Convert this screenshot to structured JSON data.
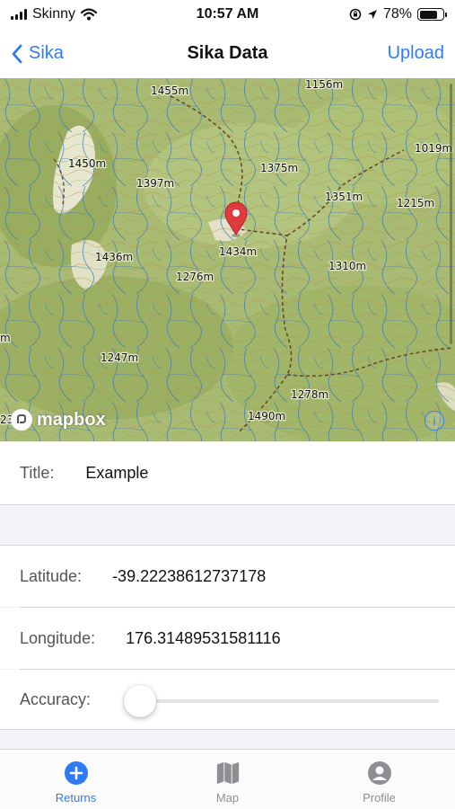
{
  "status_bar": {
    "carrier": "Skinny",
    "time": "10:57 AM",
    "battery_percent": "78%",
    "battery_level": 0.78,
    "icons": [
      "signal-icon",
      "wifi-icon",
      "orientation-lock-icon",
      "location-arrow-icon",
      "battery-icon"
    ]
  },
  "nav": {
    "back_label": "Sika",
    "title": "Sika Data",
    "action_label": "Upload"
  },
  "map": {
    "attribution": "mapbox",
    "info_symbol": "i",
    "elevation_labels": [
      "1455m",
      "1156m",
      "1019m",
      "1450m",
      "1397m",
      "1375m",
      "1351m",
      "1215m",
      "1434m",
      "1436m",
      "1276m",
      "1310m",
      "1247m",
      "1278m",
      "1490m",
      "m",
      "23"
    ]
  },
  "form": {
    "title_label": "Title:",
    "title_value": "Example",
    "latitude_label": "Latitude:",
    "latitude_value": "-39.22238612737178",
    "longitude_label": "Longitude:",
    "longitude_value": "176.31489531581116",
    "accuracy_label": "Accuracy:",
    "accuracy_value": 0
  },
  "tabs": [
    {
      "label": "Returns",
      "icon": "plus-circle-icon",
      "active": true
    },
    {
      "label": "Map",
      "icon": "map-icon",
      "active": false
    },
    {
      "label": "Profile",
      "icon": "profile-icon",
      "active": false
    }
  ],
  "colors": {
    "accent": "#2f7bf5",
    "map_base": "#a6b96e",
    "pin": "#e0393e"
  }
}
